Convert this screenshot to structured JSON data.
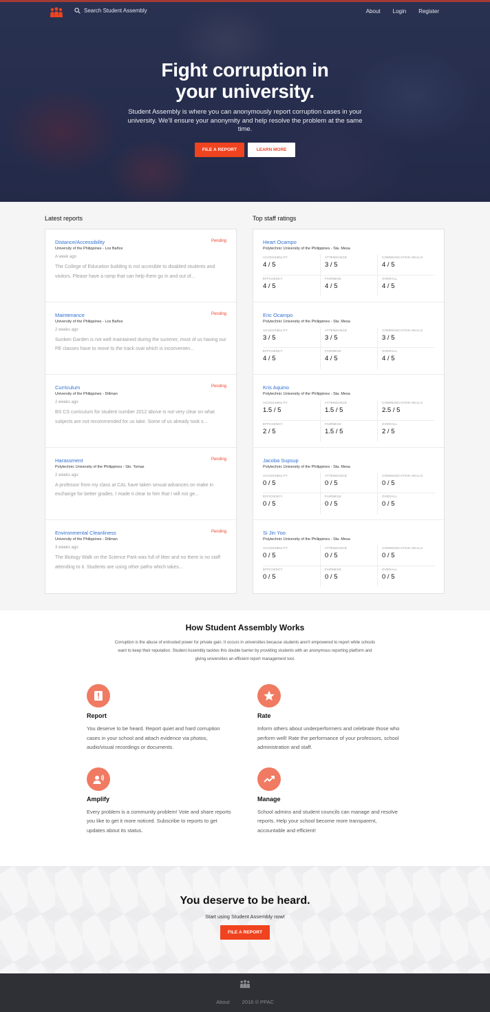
{
  "nav": {
    "search_placeholder": "Search Student Assembly",
    "links": [
      "About",
      "Login",
      "Register"
    ]
  },
  "hero": {
    "title": "Fight corruption in your university.",
    "subtitle": "Student Assembly is where you can anonymously report corruption cases in your university. We'll ensure your anonymity and help resolve the problem at the same time.",
    "primary_button": "FILE A REPORT",
    "secondary_button": "LEARN MORE"
  },
  "reports": {
    "heading": "Latest reports",
    "items": [
      {
        "title": "Distance/Accessibility",
        "status": "Pending",
        "university": "University of the Philippines - Los Baños",
        "time": "A week ago",
        "body": "The College of Education building is not accesible to disabled students and visitors. Please have a ramp that can help them go in and out of..."
      },
      {
        "title": "Maintenance",
        "status": "Pending",
        "university": "University of the Philippines - Los Baños",
        "time": "2 weeks ago",
        "body": "Sunken Garden is not well maintained during the summer, most of us having our PE classes have to move to the track oval which is inconvenien..."
      },
      {
        "title": "Curriculum",
        "status": "Pending",
        "university": "University of the Philippines - Diliman",
        "time": "2 weeks ago",
        "body": "BS CS curriculum for student number 2012 above is not very clear on what subjects are not recommended for us take. Some of us already took s..."
      },
      {
        "title": "Harassment",
        "status": "Pending",
        "university": "Polytechnic University of the Philippines - Sto. Tomas",
        "time": "2 weeks ago",
        "body": "A professor from my class at CAL have taken sexual advances on make in exchange for better grades. I made it clear to him that I will not ge..."
      },
      {
        "title": "Environmental Cleanliness",
        "status": "Pending",
        "university": "University of the Philippines - Diliman",
        "time": "3 weeks ago",
        "body": "The Biology Walk on the Science Park was full of litter and no there is no staff attending to it. Students are using other paths which takes..."
      }
    ]
  },
  "ratings": {
    "heading": "Top staff ratings",
    "labels": [
      "ACCESSIBILITY",
      "ATTENDANCE",
      "COMMUNICATION SKILLS",
      "EFFICIENCY",
      "FAIRNESS",
      "OVERALL"
    ],
    "items": [
      {
        "name": "Heart Ocampo",
        "university": "Polytechnic University of the Philippines - Sta. Mesa",
        "values": [
          "4 / 5",
          "3 / 5",
          "4 / 5",
          "4 / 5",
          "4 / 5",
          "4 / 5"
        ]
      },
      {
        "name": "Eric Ocampo",
        "university": "Polytechnic University of the Philippines - Sta. Mesa",
        "values": [
          "3 / 5",
          "3 / 5",
          "3 / 5",
          "4 / 5",
          "4 / 5",
          "4 / 5"
        ]
      },
      {
        "name": "Kris Aquino",
        "university": "Polytechnic University of the Philippines - Sta. Mesa",
        "values": [
          "1.5 / 5",
          "1.5 / 5",
          "2.5 / 5",
          "2 / 5",
          "1.5 / 5",
          "2 / 5"
        ]
      },
      {
        "name": "Jacoba Supsup",
        "university": "Polytechnic University of the Philippines - Sta. Mesa",
        "values": [
          "0 / 5",
          "0 / 5",
          "0 / 5",
          "0 / 5",
          "0 / 5",
          "0 / 5"
        ]
      },
      {
        "name": "Si Jin Yoo",
        "university": "Polytechnic University of the Philippines - Sta. Mesa",
        "values": [
          "0 / 5",
          "0 / 5",
          "0 / 5",
          "0 / 5",
          "0 / 5",
          "0 / 5"
        ]
      }
    ]
  },
  "how": {
    "title": "How Student Assembly Works",
    "description": "Corruption is the abuse of entrusted power for private gain. It occurs in universities because students aren't empowered to report while schools want to keep their reputation. Student Assembly tackles this double barrier by providing students with an anonymous reporting platform and giving universities an efficient report management tool.",
    "features": [
      {
        "icon": "report-icon",
        "title": "Report",
        "text": "You deserve to be heard. Report quiet and hard corruption cases in your school and attach evidence via photos, audio/visual recordings or documents."
      },
      {
        "icon": "star-icon",
        "title": "Rate",
        "text": "Inform others about underperformers and celebrate those who perform well! Rate the performance of your professors, school administration and staff."
      },
      {
        "icon": "amplify-icon",
        "title": "Amplify",
        "text": "Every problem is a community problem! Vote and share reports you like to get it more noticed. Subscribe to reports to get updates about its status."
      },
      {
        "icon": "trend-icon",
        "title": "Manage",
        "text": "School admins and student councils can manage and resolve reports. Help your school become more transparent, accountable and efficient!"
      }
    ]
  },
  "cta": {
    "title": "You deserve to be heard.",
    "subtitle": "Start using Student Assembly now!",
    "button": "FILE A REPORT"
  },
  "footer": {
    "links": [
      "About",
      "2016 © PPAC"
    ]
  },
  "colors": {
    "accent": "#f0431f",
    "link": "#2f6fd0",
    "icon_bg": "#f07a62",
    "hero": "#283050"
  }
}
